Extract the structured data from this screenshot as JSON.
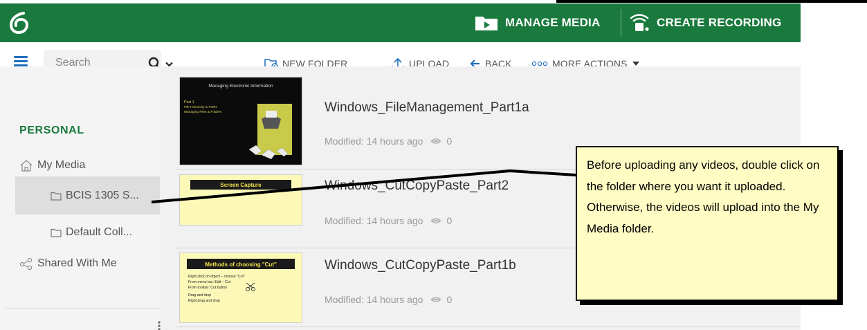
{
  "header": {
    "manage_media_label": "MANAGE MEDIA",
    "create_recording_label": "CREATE RECORDING",
    "bar_color": "#1a7a3d"
  },
  "toolbar": {
    "search_placeholder": "Search",
    "new_folder_label": "NEW FOLDER",
    "upload_label": "UPLOAD",
    "back_label": "BACK",
    "more_actions_label": "MORE ACTIONS"
  },
  "sidebar": {
    "heading": "PERSONAL",
    "my_media_label": "My Media",
    "folders": [
      {
        "label": "BCIS 1305 S...",
        "selected": true
      },
      {
        "label": "Default Coll...",
        "selected": false
      }
    ],
    "shared_label": "Shared With Me"
  },
  "entries": [
    {
      "title": "Windows_FileManagement_Part1a",
      "modified": "Modified: 14 hours ago",
      "views": "0",
      "thumb": {
        "heading": "Managing Electronic Information",
        "part": "Part 1",
        "line1": "File Hierarchy & Paths",
        "line2": "Managing Files & Folders"
      }
    },
    {
      "title": "Windows_CutCopyPaste_Part2",
      "modified": "Modified: 14 hours ago",
      "views": "0",
      "thumb": {
        "heading": "Screen Capture"
      }
    },
    {
      "title": "Windows_CutCopyPaste_Part1b",
      "modified": "Modified: 14 hours ago",
      "views": "0",
      "thumb": {
        "heading": "Methods of choosing \"Cut\"",
        "b1": "Right click on object – choose \"Cut\"",
        "b2": "From menu bar: Edit – Cut",
        "b3": "From toolbar: Cut button",
        "b4": "Drag and drop",
        "b5": "Right drag and drop"
      }
    }
  ],
  "callout": {
    "text": "Before uploading any videos, double click on the folder where you want it uploaded. Otherwise, the videos will upload into the My Media folder."
  }
}
